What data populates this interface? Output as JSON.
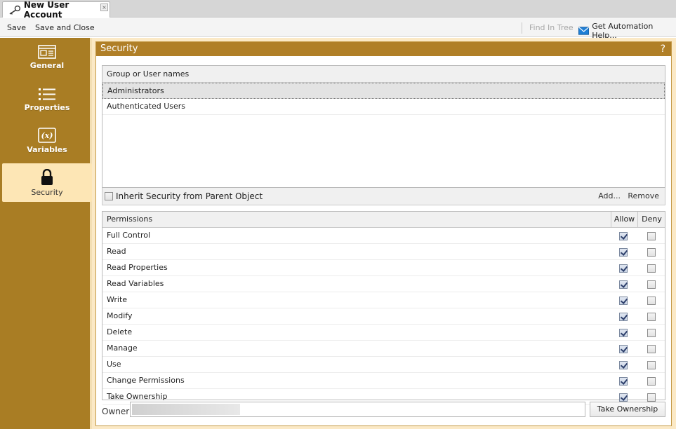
{
  "tab": {
    "title": "New User Account",
    "close": "×",
    "icon": "key-icon"
  },
  "toolbar": {
    "save_label": "Save",
    "save_close_label": "Save and Close",
    "find_in_tree_label": "Find In Tree",
    "automation_help_label": "Get Automation Help..."
  },
  "sidebar": {
    "items": [
      {
        "label": "General",
        "icon": "general-icon"
      },
      {
        "label": "Properties",
        "icon": "list-icon"
      },
      {
        "label": "Variables",
        "icon": "variable-icon"
      },
      {
        "label": "Security",
        "icon": "lock-icon",
        "selected": true
      }
    ]
  },
  "panel": {
    "title": "Security",
    "help": "?"
  },
  "groups": {
    "header": "Group or User names",
    "rows": [
      "Administrators",
      "Authenticated Users"
    ]
  },
  "inherit": {
    "label": "Inherit Security from Parent Object",
    "checked": false
  },
  "actions": {
    "add_label": "Add...",
    "remove_label": "Remove"
  },
  "permissions": {
    "headers": {
      "name": "Permissions",
      "allow": "Allow",
      "deny": "Deny"
    },
    "rows": [
      {
        "name": "Full Control",
        "allow": true,
        "deny": false
      },
      {
        "name": "Read",
        "allow": true,
        "deny": false
      },
      {
        "name": "Read Properties",
        "allow": true,
        "deny": false
      },
      {
        "name": "Read Variables",
        "allow": true,
        "deny": false
      },
      {
        "name": "Write",
        "allow": true,
        "deny": false
      },
      {
        "name": "Modify",
        "allow": true,
        "deny": false
      },
      {
        "name": "Delete",
        "allow": true,
        "deny": false
      },
      {
        "name": "Manage",
        "allow": true,
        "deny": false
      },
      {
        "name": "Use",
        "allow": true,
        "deny": false
      },
      {
        "name": "Change Permissions",
        "allow": true,
        "deny": false
      },
      {
        "name": "Take Ownership",
        "allow": true,
        "deny": false
      }
    ]
  },
  "owner": {
    "label": "Owner",
    "take_ownership_label": "Take Ownership"
  },
  "colors": {
    "sidebar": "#a97d24",
    "panel_header": "#b07f27",
    "selected_nav": "#fde6b5",
    "background": "#fbe9c6"
  }
}
